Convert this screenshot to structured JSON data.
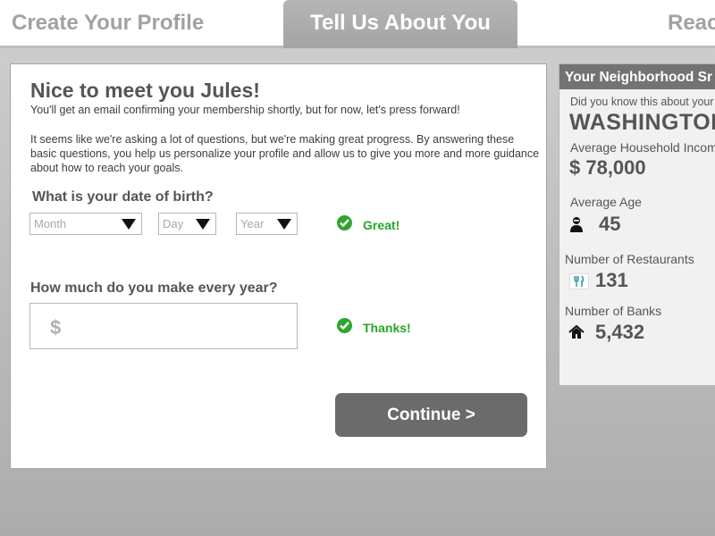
{
  "tabs": [
    {
      "label": "Create Your Profile",
      "active": false
    },
    {
      "label": "Tell Us About You",
      "active": true
    },
    {
      "label": "Reac",
      "active": false
    }
  ],
  "card": {
    "greeting": "Nice to meet you Jules!",
    "intro1": "You'll get an email confirming your membership shortly, but for now, let's press forward!",
    "intro2": "It seems like we're asking a lot of questions, but we're making great progress. By answering these basic questions, you help us personalize your profile and allow us to give you more and more guidance about how to reach your goals.",
    "dob_question": "What is your date of birth?",
    "dob_month_placeholder": "Month",
    "dob_day_placeholder": "Day",
    "dob_year_placeholder": "Year",
    "dob_feedback": "Great!",
    "income_question": "How much do you make every year?",
    "income_currency": "$",
    "income_value": "",
    "income_feedback": "Thanks!",
    "continue_label": "Continue >"
  },
  "side": {
    "title": "Your Neighborhood Sr",
    "did_you_know": "Did you know this about your n",
    "city": "WASHINGTON",
    "income_label": "Average Household Incom",
    "income_value": "$ 78,000",
    "age_label": "Average Age",
    "age_value": "45",
    "restaurants_label": "Number of Restaurants",
    "restaurants_value": "131",
    "banks_label": "Number of Banks",
    "banks_value": "5,432"
  },
  "icons": {
    "check": "check-circle-icon",
    "dropdown": "triangle-down-icon",
    "person": "person-icon",
    "restaurant": "fork-knife-icon",
    "bank": "house-icon"
  },
  "colors": {
    "success": "#2fa52f",
    "button": "#6b6b6b",
    "side_header": "#737373",
    "active_tab": "#aaaaaa"
  }
}
